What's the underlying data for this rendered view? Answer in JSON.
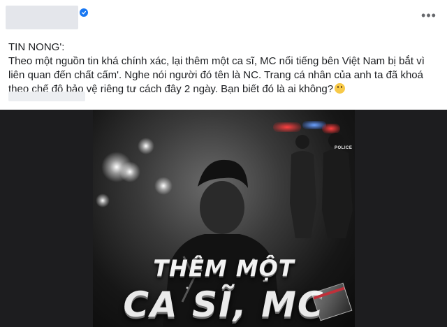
{
  "post": {
    "author_verified_icon": "verified-badge-icon",
    "more_icon": "more-options-icon",
    "more_label": "•••",
    "text_lines": [
      "TIN NONG':",
      "Theo một nguồn tin khá chính xác, lại thêm một ca sĩ, MC nổi tiếng bên Việt Nam bị bắt vì liên quan đến chất cấm'. Nghe nói người đó tên là NC. Trang cá nhân của anh ta đã khoá theo chế độ bảo vệ riêng tư cách đây 2 ngày. Bạn biết đó là ai không?"
    ],
    "emoji_icon": "thinking-face-emoji"
  },
  "image": {
    "police_text": "POLICE",
    "headline_line1": "THÊM MỘT",
    "headline_line2": "CA SĨ, MC"
  },
  "colors": {
    "verified_blue": "#1877f2",
    "text": "#1c1e21",
    "placeholder_gray": "#e4e6eb",
    "image_bg": "#1d1d1f"
  }
}
